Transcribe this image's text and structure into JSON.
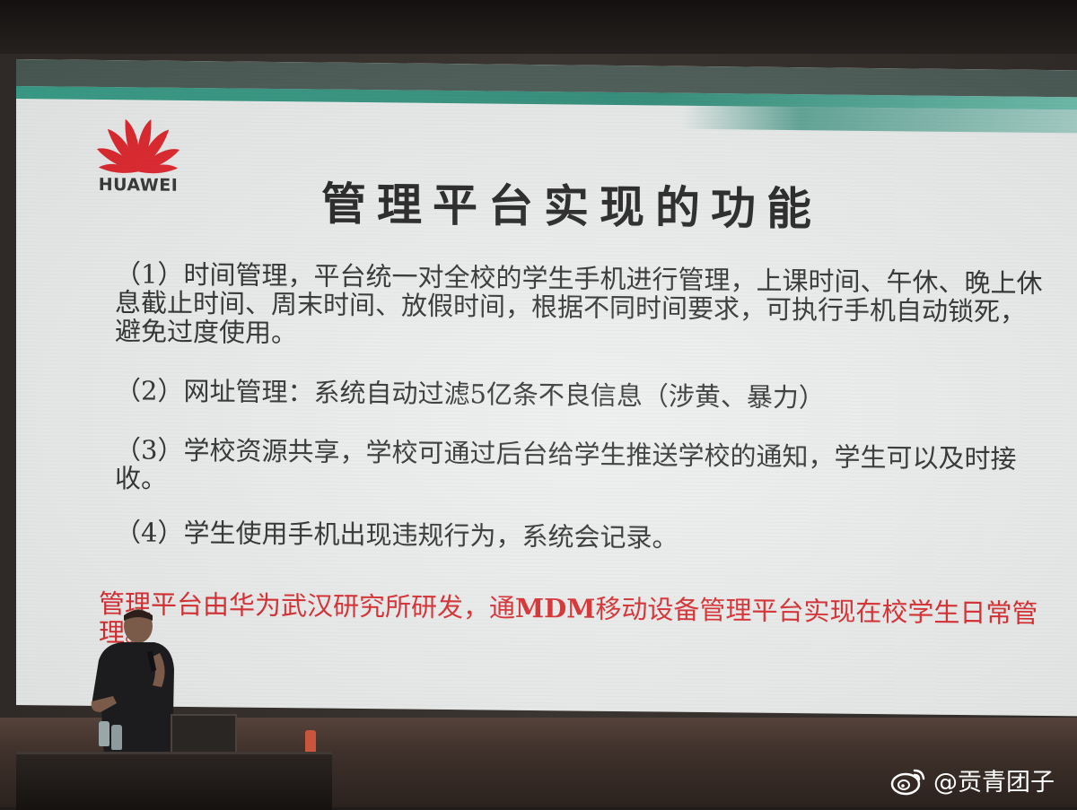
{
  "logo": {
    "brand_text": "HUAWEI",
    "brand_color": "#e0242b"
  },
  "slide": {
    "title": "管理平台实现的功能",
    "items": [
      "（1）时间管理，平台统一对全校的学生手机进行管理，上课时间、午休、晚上休息截止时间、周末时间、放假时间，根据不同时间要求，可执行手机自动锁死，避免过度使用。",
      "（2）网址管理：系统自动过滤5亿条不良信息（涉黄、暴力）",
      "（3）学校资源共享，学校可通过后台给学生推送学校的通知，学生可以及时接收。",
      "（4）学生使用手机出现违规行为，系统会记录。"
    ],
    "note_part1": "管理平台由华为武汉研究所研发，通",
    "note_bold": "MDM",
    "note_part2": "移动设备管理平台实现在校学生日常管理。",
    "note_color": "#d8262a",
    "header_color": "#2e8c78"
  },
  "watermark": {
    "text": "@贡青团子",
    "icon": "weibo-icon"
  }
}
